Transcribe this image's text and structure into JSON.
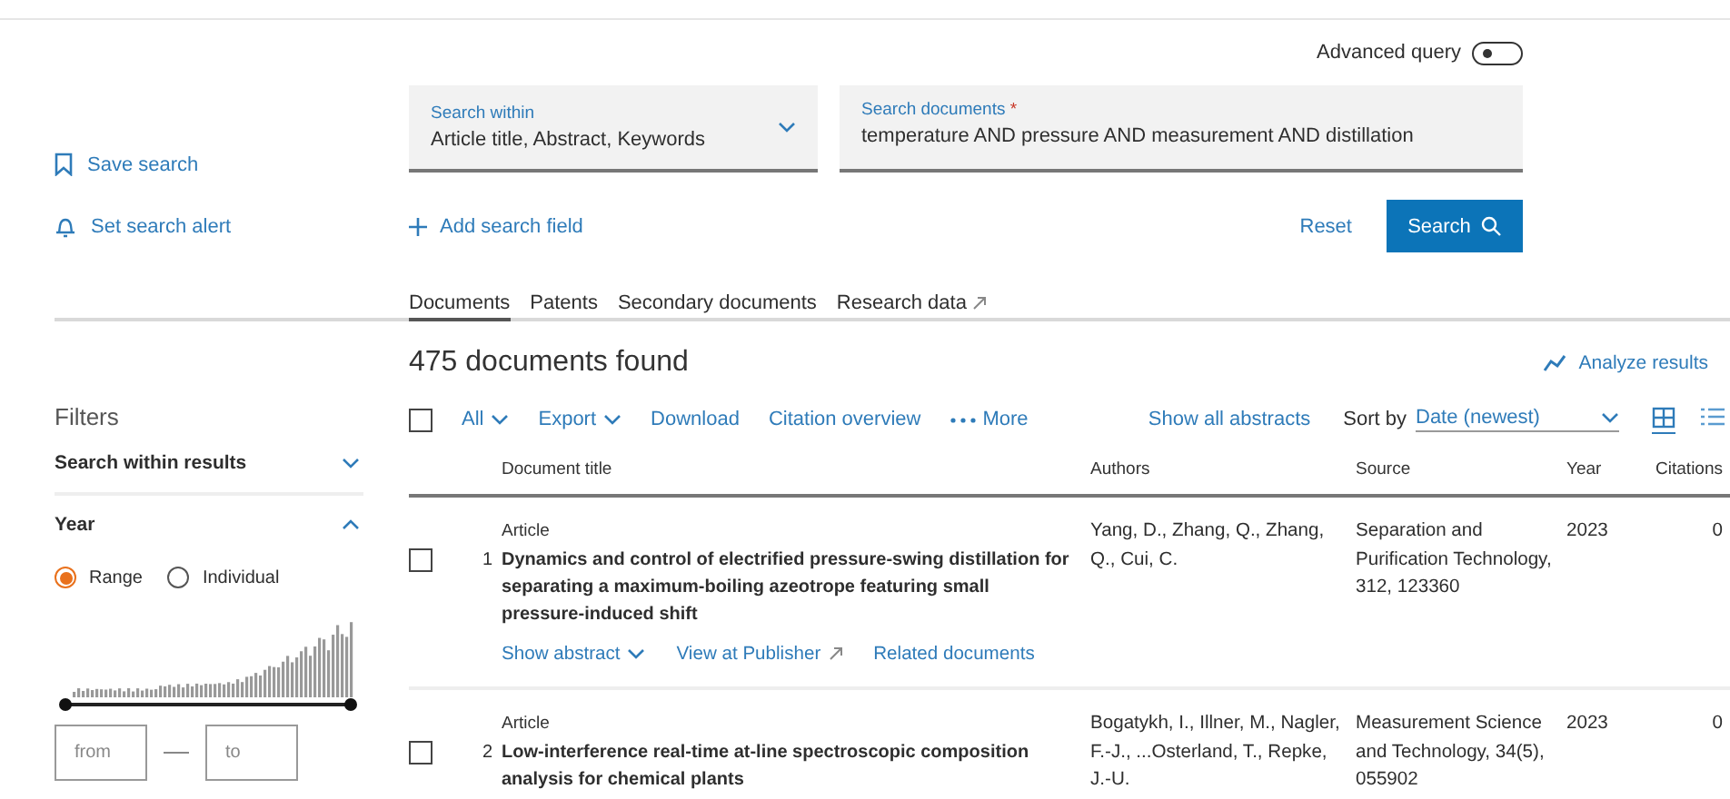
{
  "advanced_query": {
    "label": "Advanced query",
    "on": false
  },
  "sidebar_actions": [
    {
      "kind": "bookmark",
      "label": "Save search"
    },
    {
      "kind": "bell",
      "label": "Set search alert"
    }
  ],
  "search_within": {
    "label": "Search within",
    "value": "Article title, Abstract, Keywords"
  },
  "search_documents": {
    "label": "Search documents",
    "required_mark": "*",
    "value": "temperature AND pressure AND measurement AND distillation"
  },
  "add_field": "Add search field",
  "reset": "Reset",
  "search_button": "Search",
  "tabs": [
    {
      "label": "Documents",
      "selected": true,
      "external": false
    },
    {
      "label": "Patents",
      "selected": false,
      "external": false
    },
    {
      "label": "Secondary documents",
      "selected": false,
      "external": false
    },
    {
      "label": "Research data",
      "selected": false,
      "external": true
    }
  ],
  "result_count": "475 documents found",
  "analyze": "Analyze results",
  "filters": {
    "title": "Filters",
    "sections": [
      {
        "label": "Search within results",
        "expanded": false
      },
      {
        "label": "Year",
        "expanded": true
      }
    ],
    "year_modes": [
      {
        "label": "Range",
        "selected": true
      },
      {
        "label": "Individual",
        "selected": false
      }
    ],
    "range_thumbs": [
      {
        "level": 0
      },
      {
        "level": 1
      }
    ],
    "from_placeholder": "from",
    "to_placeholder": "to"
  },
  "toolbar": {
    "select_all_checked": false,
    "actions": [
      {
        "kind": "dropdown",
        "label": "All"
      },
      {
        "kind": "dropdown",
        "label": "Export"
      },
      {
        "kind": "link",
        "label": "Download"
      },
      {
        "kind": "link",
        "label": "Citation overview"
      },
      {
        "kind": "more",
        "label": "More"
      }
    ],
    "show_all_abstracts": "Show all abstracts",
    "sort_label": "Sort by",
    "sort_value": "Date (newest)",
    "views": [
      {
        "kind": "grid",
        "selected": true
      },
      {
        "kind": "list",
        "selected": false
      }
    ]
  },
  "columns": [
    "Document title",
    "Authors",
    "Source",
    "Year",
    "Citations"
  ],
  "rows": [
    {
      "checked": false,
      "number": "1",
      "type": "Article",
      "title": "Dynamics and control of electrified pressure-swing distillation for separating a maximum-boiling azeotrope featuring small pressure-induced shift",
      "authors": "Yang, D., Zhang, Q., Zhang, Q., Cui, C.",
      "source": "Separation and Purification Technology, 312, 123360",
      "year": "2023",
      "citations": "0",
      "links": [
        {
          "kind": "dropdown",
          "label": "Show abstract"
        },
        {
          "kind": "external",
          "label": "View at Publisher"
        },
        {
          "kind": "link",
          "label": "Related documents"
        }
      ]
    },
    {
      "checked": false,
      "number": "2",
      "type": "Article",
      "title": "Low-interference real-time at-line spectroscopic composition analysis for chemical plants",
      "authors": "Bogatykh, I., Illner, M., Nagler, F.-J., ...Osterland, T., Repke, J.-U.",
      "source": "Measurement Science and Technology, 34(5), 055902",
      "year": "2023",
      "citations": "0",
      "links": []
    }
  ]
}
